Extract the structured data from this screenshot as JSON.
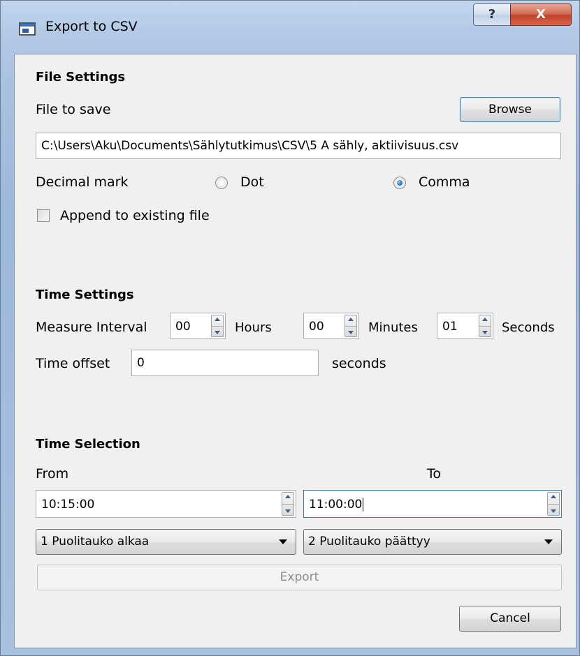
{
  "window": {
    "title": "Export to CSV",
    "help_label": "?",
    "close_label": "X"
  },
  "file_settings": {
    "heading": "File Settings",
    "file_label": "File to save",
    "browse_label": "Browse",
    "file_path": "C:\\Users\\Aku\\Documents\\Sählytutkimus\\CSV\\5 A sähly, aktiivisuus.csv",
    "decimal_label": "Decimal mark",
    "decimal_options": [
      {
        "label": "Dot",
        "selected": false
      },
      {
        "label": "Comma",
        "selected": true
      }
    ],
    "append_label": "Append to existing file",
    "append_checked": false
  },
  "time_settings": {
    "heading": "Time Settings",
    "interval_label": "Measure Interval",
    "hours_value": "00",
    "hours_label": "Hours",
    "minutes_value": "00",
    "minutes_label": "Minutes",
    "seconds_value": "01",
    "seconds_label": "Seconds",
    "offset_label": "Time offset",
    "offset_value": "0",
    "offset_unit": "seconds"
  },
  "time_selection": {
    "heading": "Time Selection",
    "from_label": "From",
    "to_label": "To",
    "from_time": "10:15:00",
    "to_time": "11:00:00",
    "from_event": "1 Puolitauko alkaa",
    "to_event": "2 Puolitauko päättyy"
  },
  "actions": {
    "export_label": "Export",
    "export_enabled": false,
    "cancel_label": "Cancel"
  },
  "colors": {
    "accent": "#3c7fb1",
    "close_button": "#c0432a",
    "dialog_bg": "#f0f0f0"
  }
}
